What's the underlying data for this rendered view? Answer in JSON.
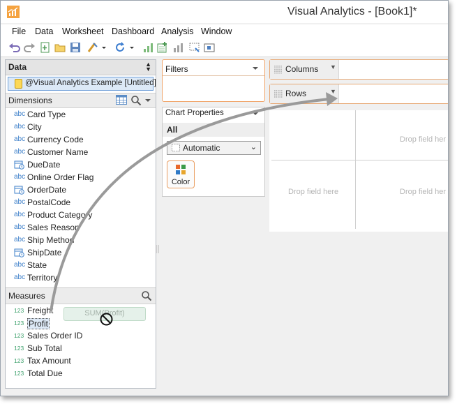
{
  "window": {
    "title": "Visual Analytics - [Book1]*"
  },
  "menu": [
    "File",
    "Data",
    "Worksheet",
    "Dashboard",
    "Analysis",
    "Window"
  ],
  "toolbar": {
    "icons": [
      "undo-icon",
      "redo-icon",
      "new-worksheet-icon",
      "open-icon",
      "save-icon",
      "clear-icon",
      "dropdown-icon",
      "refresh-icon",
      "dropdown-icon",
      "sort-ascending-icon",
      "add-data-icon",
      "chart-icon",
      "filter-icon",
      "fit-icon"
    ]
  },
  "data_panel": {
    "title": "Data",
    "source": "@Visual Analytics Example [Untitled]",
    "dimensions_label": "Dimensions",
    "dimensions": [
      {
        "type": "abc",
        "name": "Card Type"
      },
      {
        "type": "abc",
        "name": "City"
      },
      {
        "type": "abc",
        "name": "Currency Code"
      },
      {
        "type": "abc",
        "name": "Customer Name"
      },
      {
        "type": "date",
        "name": "DueDate"
      },
      {
        "type": "abc",
        "name": "Online Order Flag"
      },
      {
        "type": "date",
        "name": "OrderDate"
      },
      {
        "type": "abc",
        "name": "PostalCode"
      },
      {
        "type": "abc",
        "name": "Product Category"
      },
      {
        "type": "abc",
        "name": "Sales Reason"
      },
      {
        "type": "abc",
        "name": "Ship Method"
      },
      {
        "type": "date",
        "name": "ShipDate"
      },
      {
        "type": "abc",
        "name": "State"
      },
      {
        "type": "abc",
        "name": "Territory"
      }
    ],
    "measures_label": "Measures",
    "measures": [
      {
        "type": "123",
        "name": "Freight"
      },
      {
        "type": "123",
        "name": "Profit"
      },
      {
        "type": "123",
        "name": "Sales Order ID"
      },
      {
        "type": "123",
        "name": "Sub Total"
      },
      {
        "type": "123",
        "name": "Tax Amount"
      },
      {
        "type": "123",
        "name": "Total Due"
      }
    ]
  },
  "filters": {
    "label": "Filters"
  },
  "chart_properties": {
    "label": "Chart Properties",
    "all": "All",
    "mark_type": "Automatic",
    "color_label": "Color"
  },
  "shelves": {
    "columns": "Columns",
    "rows": "Rows"
  },
  "canvas": {
    "drop_hint": "Drop field here",
    "drop_hint_truncated": "Drop field her"
  },
  "drag": {
    "label": "SUM(Profit)"
  },
  "colors": {
    "accent": "#e99c5e",
    "selection": "#dce9f7",
    "arrow": "#9a9a9a"
  }
}
